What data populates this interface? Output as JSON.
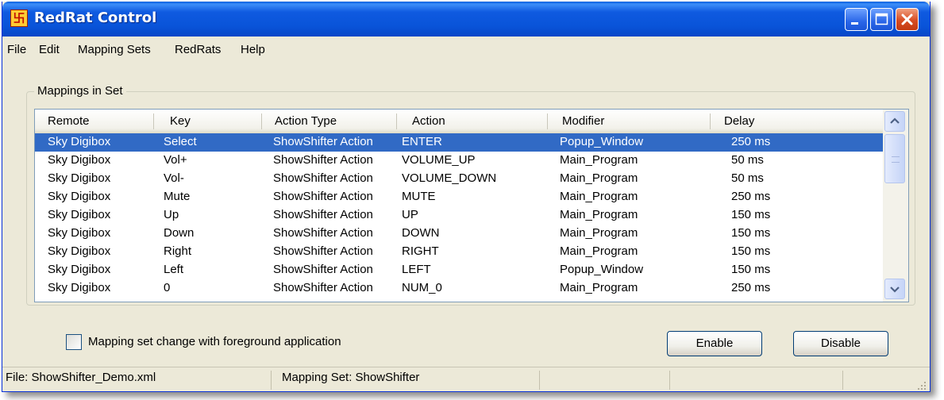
{
  "window": {
    "title": "RedRat Control",
    "controls": {
      "minimize": "minimize-icon",
      "maximize": "maximize-icon",
      "close": "close-icon"
    }
  },
  "menu": [
    "File",
    "Edit",
    "Mapping Sets",
    "RedRats",
    "Help"
  ],
  "group": {
    "label": "Mappings in Set"
  },
  "table": {
    "columns": [
      "Remote",
      "Key",
      "Action Type",
      "Action",
      "Modifier",
      "Delay"
    ],
    "rows": [
      [
        "Sky Digibox",
        "Select",
        "ShowShifter Action",
        "ENTER",
        "Popup_Window",
        "250 ms"
      ],
      [
        "Sky Digibox",
        "Vol+",
        "ShowShifter Action",
        "VOLUME_UP",
        "Main_Program",
        "50 ms"
      ],
      [
        "Sky Digibox",
        "Vol-",
        "ShowShifter Action",
        "VOLUME_DOWN",
        "Main_Program",
        "50 ms"
      ],
      [
        "Sky Digibox",
        "Mute",
        "ShowShifter Action",
        "MUTE",
        "Main_Program",
        "250 ms"
      ],
      [
        "Sky Digibox",
        "Up",
        "ShowShifter Action",
        "UP",
        "Main_Program",
        "150 ms"
      ],
      [
        "Sky Digibox",
        "Down",
        "ShowShifter Action",
        "DOWN",
        "Main_Program",
        "150 ms"
      ],
      [
        "Sky Digibox",
        "Right",
        "ShowShifter Action",
        "RIGHT",
        "Main_Program",
        "150 ms"
      ],
      [
        "Sky Digibox",
        "Left",
        "ShowShifter Action",
        "LEFT",
        "Popup_Window",
        "150 ms"
      ],
      [
        "Sky Digibox",
        "0",
        "ShowShifter Action",
        "NUM_0",
        "Main_Program",
        "250 ms"
      ]
    ],
    "selected_row": 0
  },
  "options": {
    "foreground_change_label": "Mapping set change with foreground application",
    "foreground_change_checked": false
  },
  "buttons": {
    "enable": "Enable",
    "disable": "Disable"
  },
  "status": {
    "file": "File: ShowShifter_Demo.xml",
    "mapping_set": "Mapping Set: ShowShifter"
  },
  "colors": {
    "titlebar": "#0954d9",
    "selection": "#316ac5",
    "window_bg": "#ece9d8",
    "close_button": "#d84c22"
  }
}
